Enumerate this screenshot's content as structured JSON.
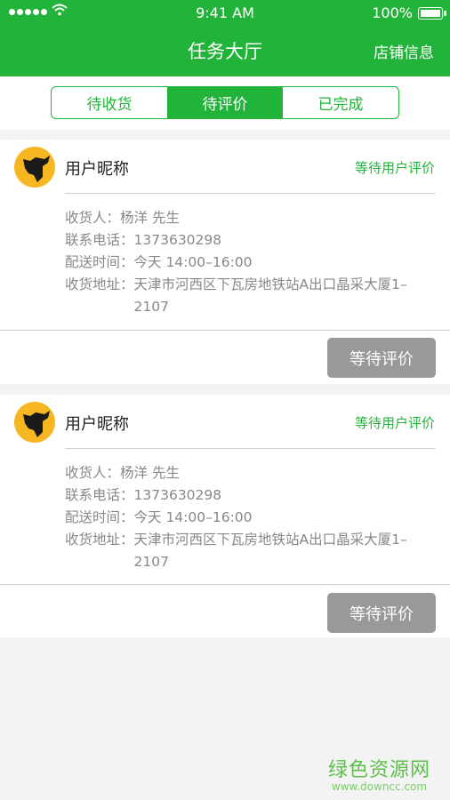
{
  "status_bar": {
    "time": "9:41 AM",
    "battery": "100%"
  },
  "nav": {
    "title": "任务大厅",
    "right_action": "店铺信息"
  },
  "tabs": [
    {
      "label": "待收货",
      "active": false
    },
    {
      "label": "待评价",
      "active": true
    },
    {
      "label": "已完成",
      "active": false
    }
  ],
  "orders": [
    {
      "username": "用户昵称",
      "status": "等待用户评价",
      "receiver_label": "收货人：",
      "receiver": "杨洋 先生",
      "phone_label": "联系电话：",
      "phone": "1373630298",
      "time_label": "配送时间：",
      "time": "今天 14:00–16:00",
      "address_label": "收货地址：",
      "address": "天津市河西区下瓦房地铁站A出口晶采大厦1–2107",
      "action": "等待评价"
    },
    {
      "username": "用户昵称",
      "status": "等待用户评价",
      "receiver_label": "收货人：",
      "receiver": "杨洋 先生",
      "phone_label": "联系电话：",
      "phone": "1373630298",
      "time_label": "配送时间：",
      "time": "今天 14:00–16:00",
      "address_label": "收货地址：",
      "address": "天津市河西区下瓦房地铁站A出口晶采大厦1–2107",
      "action": "等待评价"
    }
  ],
  "watermark": {
    "name": "绿色资源网",
    "url": "www.downcc.com"
  },
  "colors": {
    "brand": "#22b43a",
    "button_disabled": "#999999",
    "avatar_bg": "#f6b722"
  }
}
